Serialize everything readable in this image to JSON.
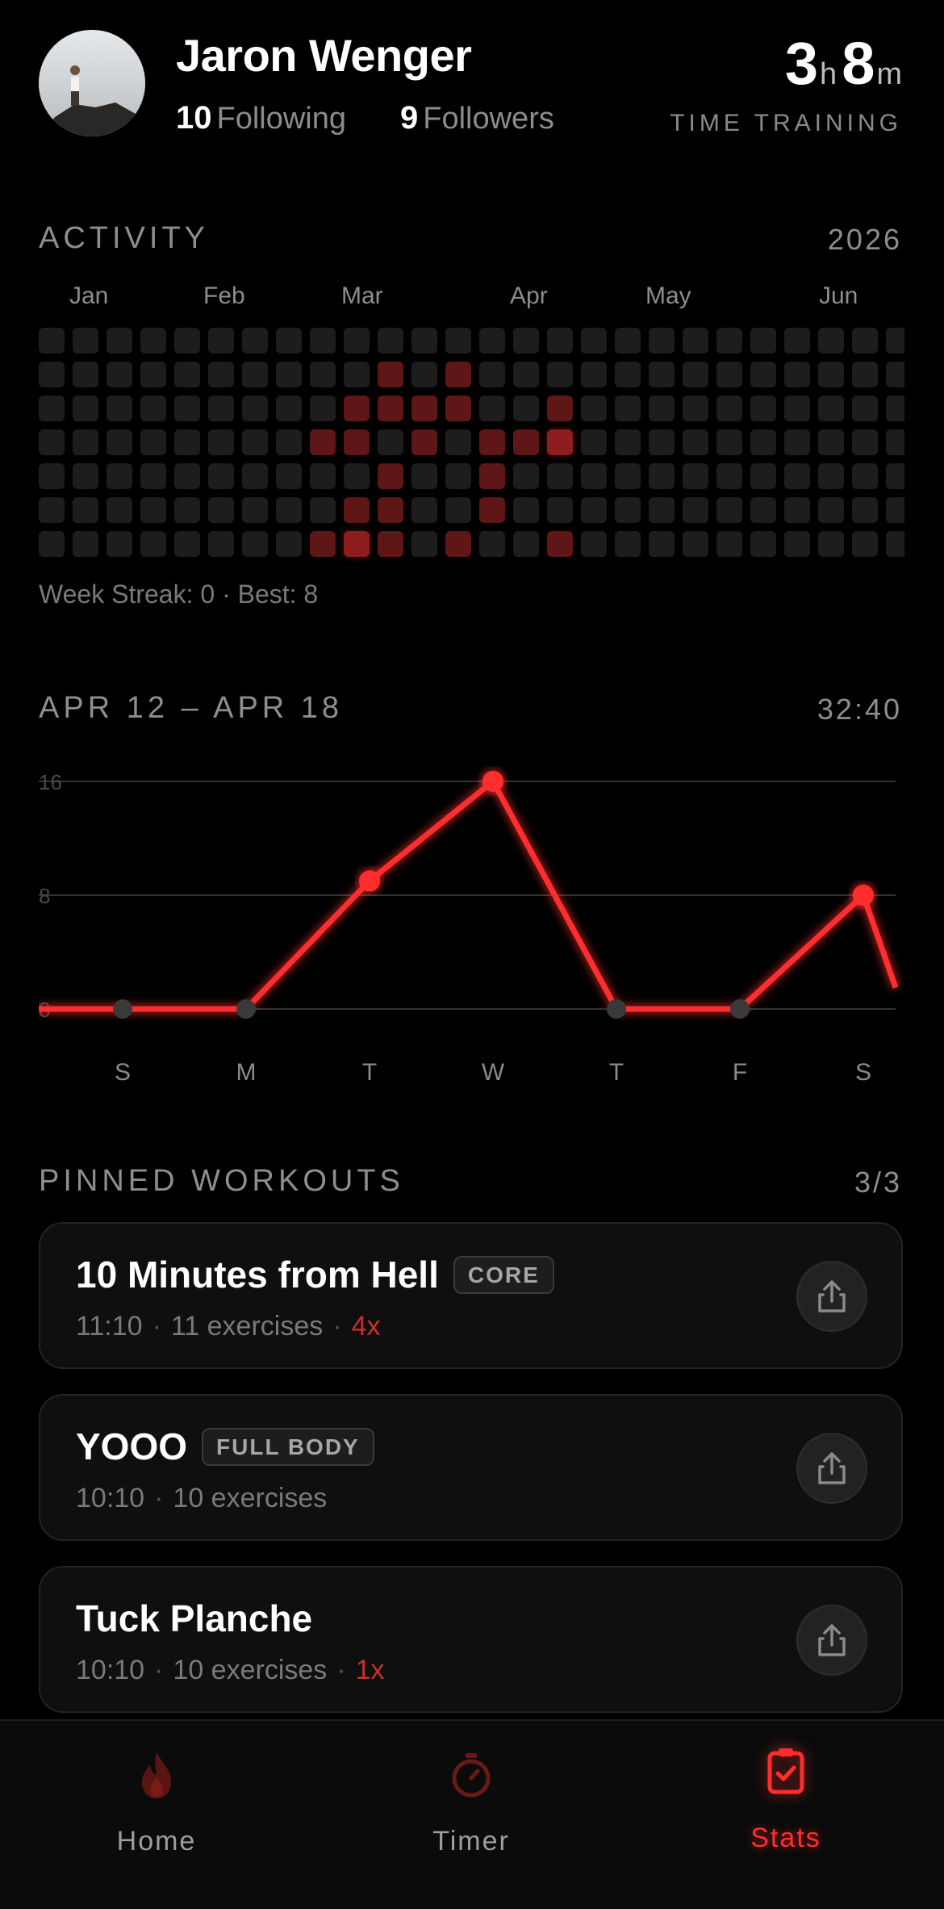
{
  "profile": {
    "name": "Jaron Wenger",
    "following_count": "10",
    "following_label": "Following",
    "followers_count": "9",
    "followers_label": "Followers",
    "time_hours": "3",
    "time_hours_unit": "h",
    "time_minutes": "8",
    "time_minutes_unit": "m",
    "time_label": "TIME TRAINING"
  },
  "activity": {
    "title": "ACTIVITY",
    "year": "2026",
    "months": [
      "Jan",
      "Feb",
      "Mar",
      "Apr",
      "May",
      "Jun"
    ],
    "weeks": 27,
    "days": 7,
    "active_cells": [
      {
        "week": 10,
        "day": 1,
        "level": 1
      },
      {
        "week": 12,
        "day": 1,
        "level": 1
      },
      {
        "week": 9,
        "day": 2,
        "level": 1
      },
      {
        "week": 10,
        "day": 2,
        "level": 1
      },
      {
        "week": 11,
        "day": 2,
        "level": 1
      },
      {
        "week": 12,
        "day": 2,
        "level": 1
      },
      {
        "week": 15,
        "day": 2,
        "level": 1
      },
      {
        "week": 8,
        "day": 3,
        "level": 1
      },
      {
        "week": 9,
        "day": 3,
        "level": 1
      },
      {
        "week": 11,
        "day": 3,
        "level": 1
      },
      {
        "week": 13,
        "day": 3,
        "level": 1
      },
      {
        "week": 14,
        "day": 3,
        "level": 1
      },
      {
        "week": 15,
        "day": 3,
        "level": 2
      },
      {
        "week": 10,
        "day": 4,
        "level": 1
      },
      {
        "week": 13,
        "day": 4,
        "level": 1
      },
      {
        "week": 9,
        "day": 5,
        "level": 1
      },
      {
        "week": 10,
        "day": 5,
        "level": 1
      },
      {
        "week": 13,
        "day": 5,
        "level": 1
      },
      {
        "week": 8,
        "day": 6,
        "level": 1
      },
      {
        "week": 9,
        "day": 6,
        "level": 2
      },
      {
        "week": 10,
        "day": 6,
        "level": 1
      },
      {
        "week": 12,
        "day": 6,
        "level": 1
      },
      {
        "week": 15,
        "day": 6,
        "level": 1
      }
    ],
    "streak_text": "Week Streak: 0 · Best: 8"
  },
  "week": {
    "title": "APR 12 – APR 18",
    "total": "32:40"
  },
  "chart_data": {
    "type": "line",
    "categories": [
      "S",
      "M",
      "T",
      "W",
      "T",
      "F",
      "S"
    ],
    "values": [
      0,
      0,
      9,
      16,
      0,
      0,
      8
    ],
    "y_ticks": [
      0,
      8,
      16
    ],
    "ylim": [
      0,
      16
    ],
    "color": "#ff2d2d",
    "grid": true
  },
  "pinned": {
    "title": "PINNED WORKOUTS",
    "count": "3/3",
    "items": [
      {
        "title": "10 Minutes from Hell",
        "tag": "CORE",
        "duration": "11:10",
        "sep1": "·",
        "exercises": "11 exercises",
        "sep2": "·",
        "times": "4x"
      },
      {
        "title": "YOOO",
        "tag": "FULL BODY",
        "duration": "10:10",
        "sep1": "·",
        "exercises": "10 exercises",
        "sep2": "",
        "times": ""
      },
      {
        "title": "Tuck Planche",
        "tag": "",
        "duration": "10:10",
        "sep1": "·",
        "exercises": "10 exercises",
        "sep2": "·",
        "times": "1x"
      }
    ]
  },
  "tabs": [
    {
      "label": "Home",
      "icon": "flame-icon"
    },
    {
      "label": "Timer",
      "icon": "stopwatch-icon"
    },
    {
      "label": "Stats",
      "icon": "clipboard-check-icon",
      "active": true
    }
  ],
  "colors": {
    "accent": "#ff2d2d",
    "background": "#000000"
  }
}
